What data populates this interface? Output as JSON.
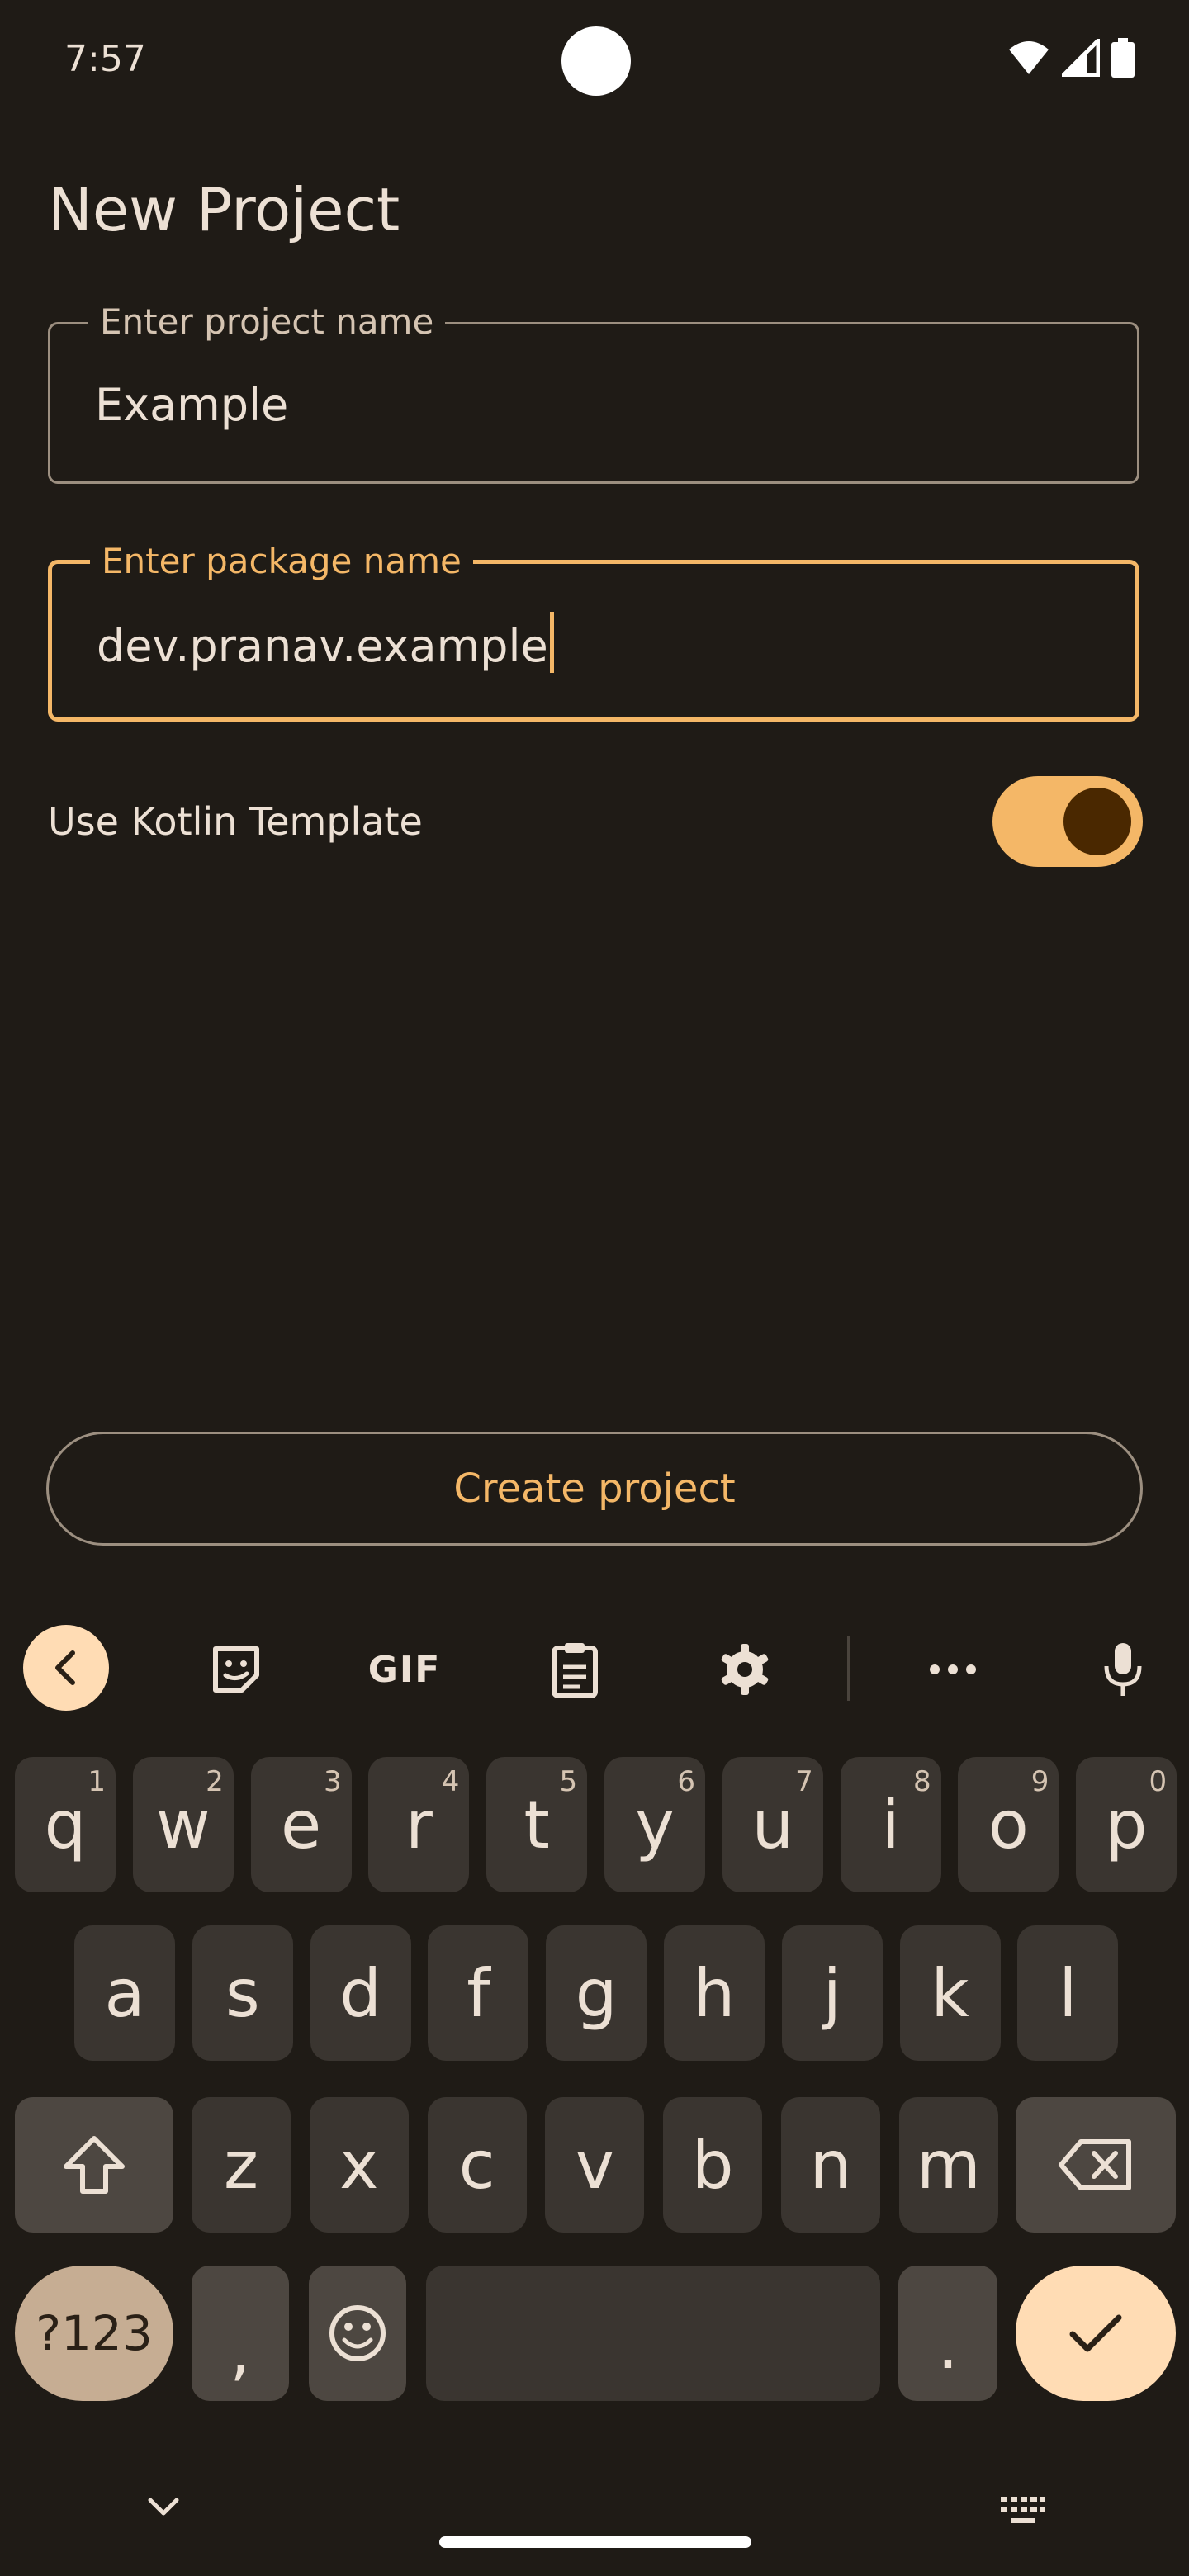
{
  "status_bar": {
    "time": "7:57",
    "icons": [
      "wifi-icon",
      "signal-icon",
      "battery-icon"
    ]
  },
  "title": "New Project",
  "fields": {
    "project_name": {
      "label": "Enter project name",
      "value": "Example"
    },
    "package_name": {
      "label": "Enter package name",
      "value": "dev.pranav.example"
    }
  },
  "kotlin_switch": {
    "label": "Use Kotlin Template",
    "on": true
  },
  "create_button": "Create project",
  "keyboard": {
    "toolbar": {
      "items": [
        "back-chevron-icon",
        "sticker-icon",
        "gif",
        "clipboard-icon",
        "settings-gear-icon",
        "more-dots-icon",
        "microphone-icon"
      ],
      "gif_label": "GIF"
    },
    "row1": [
      {
        "k": "q",
        "h": "1"
      },
      {
        "k": "w",
        "h": "2"
      },
      {
        "k": "e",
        "h": "3"
      },
      {
        "k": "r",
        "h": "4"
      },
      {
        "k": "t",
        "h": "5"
      },
      {
        "k": "y",
        "h": "6"
      },
      {
        "k": "u",
        "h": "7"
      },
      {
        "k": "i",
        "h": "8"
      },
      {
        "k": "o",
        "h": "9"
      },
      {
        "k": "p",
        "h": "0"
      }
    ],
    "row2": [
      "a",
      "s",
      "d",
      "f",
      "g",
      "h",
      "j",
      "k",
      "l"
    ],
    "row3": [
      "z",
      "x",
      "c",
      "v",
      "b",
      "n",
      "m"
    ],
    "row4": {
      "symbols": "?123",
      "comma": ",",
      "period": "."
    }
  },
  "colors": {
    "background": "#1f1b16",
    "accent": "#f4b767",
    "on_surface": "#ece0d4",
    "outline": "#9c8f80"
  }
}
